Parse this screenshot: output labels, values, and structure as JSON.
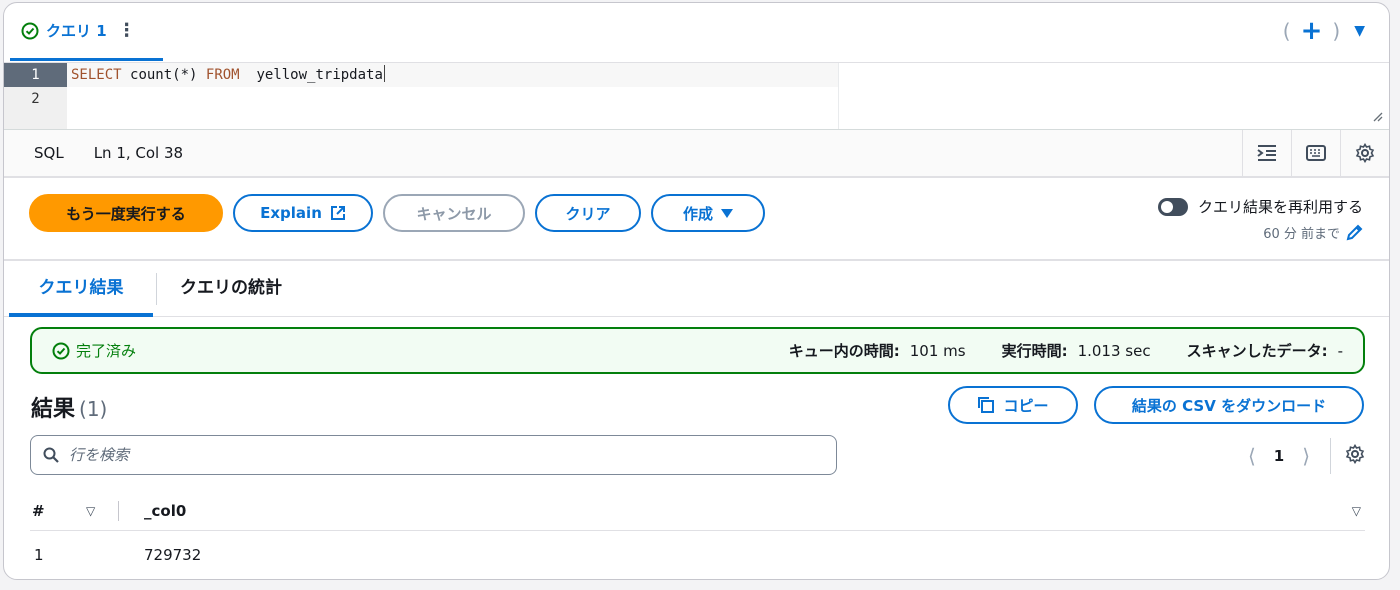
{
  "query_tab": {
    "label": "クエリ 1",
    "menu_glyph": "⋮"
  },
  "tab_actions": {
    "open_paren": "(",
    "plus": "+",
    "close_paren": ")",
    "caret": "▼"
  },
  "editor": {
    "lines": [
      {
        "number": "1",
        "keyword1": "SELECT",
        "func": "count(*)",
        "keyword2": "FROM",
        "table": "yellow_tripdata"
      },
      {
        "number": "2"
      }
    ]
  },
  "status_bar": {
    "language": "SQL",
    "cursor_position": "Ln 1, Col 38"
  },
  "actions": {
    "run_again": "もう一度実行する",
    "explain": "Explain",
    "cancel": "キャンセル",
    "clear": "クリア",
    "create": "作成"
  },
  "reuse": {
    "label": "クエリ結果を再利用する",
    "age": "60 分 前まで",
    "enabled": false
  },
  "result_tabs": {
    "results": "クエリ結果",
    "stats": "クエリの統計"
  },
  "banner": {
    "status": "完了済み",
    "queue_label": "キュー内の時間:",
    "queue_value": "101 ms",
    "exec_label": "実行時間:",
    "exec_value": "1.013 sec",
    "scan_label": "スキャンしたデータ:",
    "scan_value": "-"
  },
  "results": {
    "title": "結果",
    "count": "(1)",
    "copy": "コピー",
    "download_csv": "結果の CSV をダウンロード",
    "search_placeholder": "行を検索",
    "page": "1"
  },
  "table": {
    "columns": [
      "#",
      "_col0"
    ],
    "rows": [
      [
        "1",
        "729732"
      ]
    ]
  },
  "colors": {
    "accent": "#0972d3",
    "primary": "#ff9900",
    "success": "#037f0c"
  }
}
